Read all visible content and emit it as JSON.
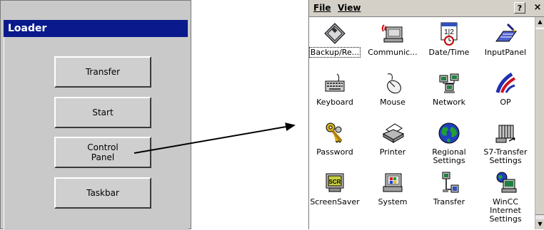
{
  "loader": {
    "title": "Loader",
    "buttons": [
      {
        "label": "Transfer"
      },
      {
        "label": "Start"
      },
      {
        "label": "Control\nPanel"
      },
      {
        "label": "Taskbar"
      }
    ]
  },
  "control_panel": {
    "menu": {
      "file": "File",
      "view": "View",
      "help": "?",
      "close": "×"
    },
    "items": [
      {
        "label": "Backup/Re...",
        "icon": "floppy-disk-icon"
      },
      {
        "label": "Communic...",
        "icon": "communication-icon"
      },
      {
        "label": "Date/Time",
        "icon": "calendar-clock-icon"
      },
      {
        "label": "InputPanel",
        "icon": "input-panel-icon"
      },
      {
        "label": "Keyboard",
        "icon": "keyboard-icon"
      },
      {
        "label": "Mouse",
        "icon": "mouse-icon"
      },
      {
        "label": "Network",
        "icon": "network-icon"
      },
      {
        "label": "OP",
        "icon": "siemens-op-icon"
      },
      {
        "label": "Password",
        "icon": "keys-icon"
      },
      {
        "label": "Printer",
        "icon": "printer-icon"
      },
      {
        "label": "Regional\nSettings",
        "icon": "globe-icon"
      },
      {
        "label": "S7-Transfer\nSettings",
        "icon": "s7-transfer-icon"
      },
      {
        "label": "ScreenSaver",
        "icon": "screensaver-icon"
      },
      {
        "label": "System",
        "icon": "system-computer-icon"
      },
      {
        "label": "Transfer",
        "icon": "transfer-icon"
      },
      {
        "label": "WinCC\nInternet\nSettings",
        "icon": "wincc-internet-icon"
      }
    ]
  }
}
